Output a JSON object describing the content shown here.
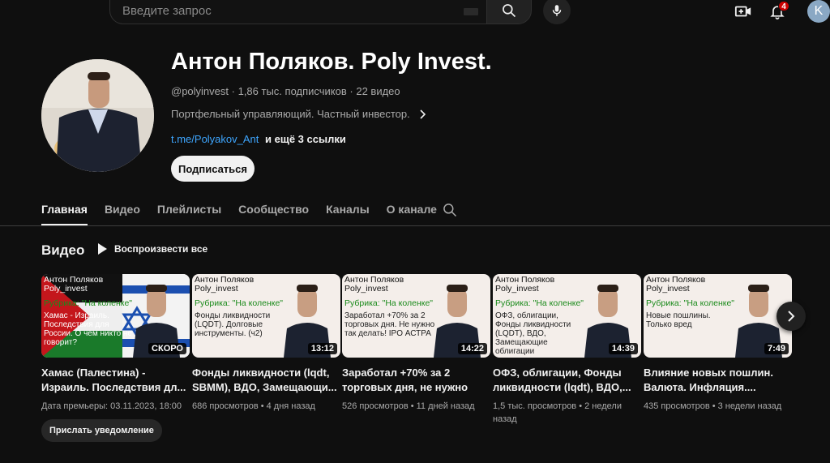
{
  "search": {
    "placeholder": "Введите запрос"
  },
  "notifications": {
    "count": "4"
  },
  "user": {
    "initial": "K"
  },
  "channel": {
    "title": "Антон Поляков. Poly Invest.",
    "handle": "@polyinvest",
    "subscribers": "1,86 тыс. подписчиков",
    "videos_count": "22 видео",
    "description": "Портфельный управляющий. Частный инвестор.",
    "link": "t.me/Polyakov_Ant",
    "more_links": "и ещё 3 ссылки",
    "subscribe_label": "Подписаться"
  },
  "tabs": [
    {
      "label": "Главная",
      "active": true
    },
    {
      "label": "Видео"
    },
    {
      "label": "Плейлисты"
    },
    {
      "label": "Сообщество"
    },
    {
      "label": "Каналы"
    },
    {
      "label": "О канале"
    }
  ],
  "section": {
    "title": "Видео",
    "play_all": "Воспроизвести все"
  },
  "videos": [
    {
      "thumb_name": "Антон Поляков\nPoly_invest",
      "thumb_rubric": "Рубрика: \"На коленке\"",
      "thumb_text": "Хамас - Израиль. Последствия для России. О чем никто не говорит?",
      "badge": "СКОРО",
      "title": "Хамас (Палестина) - Израиль. Последствия дл...",
      "meta": "Дата премьеры: 03.11.2023, 18:00",
      "notify": "Прислать уведомление"
    },
    {
      "thumb_name": "Антон Поляков\nPoly_invest",
      "thumb_rubric": "Рубрика: \"На коленке\"",
      "thumb_text": "Фонды ликвидности (LQDT). Долговые инструменты. (ч2)",
      "badge": "13:12",
      "title": "Фонды ликвидности (lqdt, SBMM), ВДО, Замещающи...",
      "meta": "686 просмотров • 4 дня назад"
    },
    {
      "thumb_name": "Антон Поляков\nPoly_invest",
      "thumb_rubric": "Рубрика: \"На коленке\"",
      "thumb_text": "Заработал +70% за 2 торговых дня. Не нужно так делать! IPO АСТРА",
      "badge": "14:22",
      "title": "Заработал +70% за 2 торговых дня, не нужно та...",
      "meta": "526 просмотров • 11 дней назад"
    },
    {
      "thumb_name": "Антон Поляков\nPoly_invest",
      "thumb_rubric": "Рубрика: \"На коленке\"",
      "thumb_text": "ОФЗ, облигации, Фонды ликвидности (LQDT), ВДО, Замещающие облигации",
      "badge": "14:39",
      "title": "ОФЗ, облигации, Фонды ликвидности (lqdt), ВДО,...",
      "meta": "1,5 тыс. просмотров • 2 недели назад"
    },
    {
      "thumb_name": "Антон Поляков\nPoly_invest",
      "thumb_rubric": "Рубрика: \"На коленке\"",
      "thumb_text": "Новые пошлины. Только вред",
      "badge": "7:49",
      "title": "Влияние новых пошлин. Валюта. Инфляция....",
      "meta": "435 просмотров • 3 недели назад"
    }
  ],
  "colors": {
    "background": "#0f0f0f",
    "link": "#3ea6ff",
    "badge": "#cc0000",
    "rubric": "#1a8a1a"
  }
}
